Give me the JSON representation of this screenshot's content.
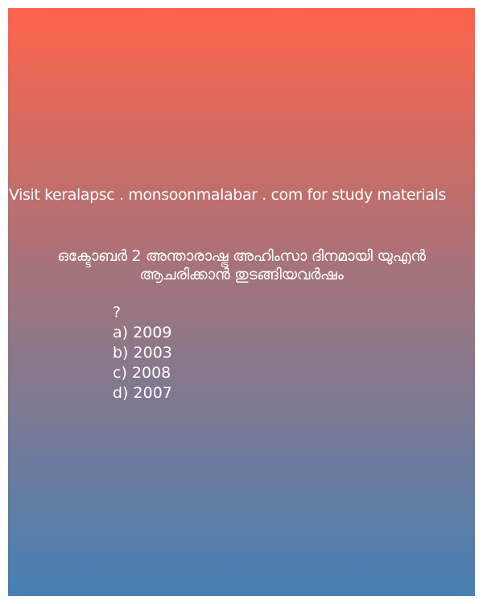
{
  "colors": {
    "gradient_top": "#fe634a",
    "gradient_middle": "#9b7580",
    "gradient_bottom": "#4680b4",
    "text": "#ffffff"
  },
  "watermark": "Visit keralapsc . monsoonmalabar . com for study materials",
  "question": {
    "line1": "ഒക്ടോബർ 2 അന്താരാഷ്ട്ര അഹിംസാ ദിനമായി യുഎൻ",
    "line2": "ആചരിക്കാൻ  തുടങ്ങിയവർഷം",
    "mark": "?"
  },
  "options": [
    {
      "label": "a) 2009"
    },
    {
      "label": "b) 2003"
    },
    {
      "label": "c) 2008"
    },
    {
      "label": "d) 2007"
    }
  ]
}
